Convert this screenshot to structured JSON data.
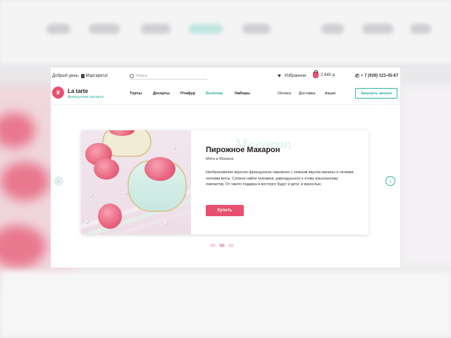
{
  "topbar": {
    "greeting": "Добрый день,",
    "user_name": "Маргарита!",
    "search_placeholder": "Поиск",
    "favorites_label": "Избранное",
    "cart_total": "2 640 р.",
    "phone": "+ 7 (939) 123-45-67"
  },
  "header": {
    "brand": "La tarte",
    "tagline": "французские десерты",
    "menu": [
      "Торты",
      "Десерты",
      "Птифур",
      "Выпечка",
      "Наборы"
    ],
    "active_menu": "Выпечка",
    "secondary_menu": [
      "Оплата",
      "Доставка",
      "Акции"
    ],
    "call_button": "Заказать звонок"
  },
  "slide": {
    "watermark": "Macaron",
    "title": "Пирожное Макарон",
    "subtitle": "Мята и Малина",
    "description": "Необыкновенно вкусное французское пирожное с нежным вкусом малины и легкими нотками мяты. Сложно найти человека, равнодушного к этому изысканному лакомству. От такого подарка в восторге будут и дети, и взрослые.",
    "buy_button": "Купить",
    "prev_icon": "chevron-left-icon",
    "next_icon": "chevron-right-icon"
  },
  "pagination": {
    "count": 3,
    "active_index": 1
  },
  "colors": {
    "accent_pink": "#e7506f",
    "accent_teal": "#2bb3a3",
    "page_bg": "#ffffff",
    "backdrop": "#e9e8ea"
  }
}
